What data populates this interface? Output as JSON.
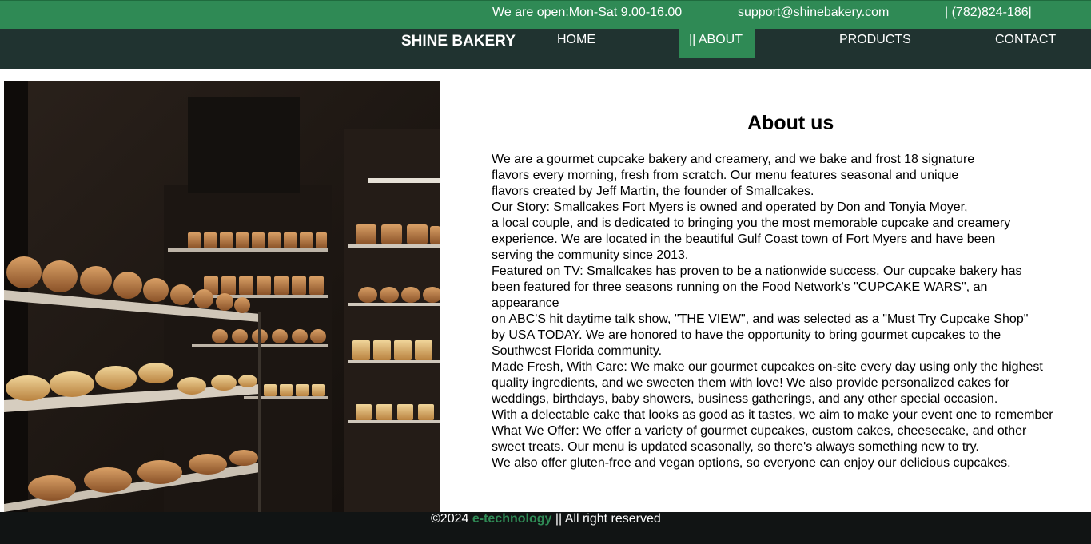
{
  "topbar": {
    "hours": "We are open:Mon-Sat 9.00-16.00",
    "email": "support@shinebakery.com",
    "phone": "| (782)824-186|"
  },
  "nav": {
    "brand": "SHINE BAKERY",
    "items": [
      {
        "label": "HOME"
      },
      {
        "label": "|| ABOUT"
      },
      {
        "label": "PRODUCTS"
      },
      {
        "label": "CONTACT"
      }
    ],
    "active_color": "#2f8a55"
  },
  "hero": {
    "image": "bakery-shelves-photo"
  },
  "about": {
    "title": "About us",
    "lines": [
      "We are a gourmet cupcake bakery and creamery, and we bake and frost 18 signature",
      "flavors every morning, fresh from scratch. Our menu features seasonal and unique",
      "flavors created by Jeff Martin, the founder of Smallcakes.",
      "Our Story: Smallcakes Fort Myers is owned and operated by Don and Tonyia Moyer,",
      "a local couple, and is dedicated to bringing you the most memorable cupcake and creamery",
      "experience. We are located in the beautiful Gulf Coast town of Fort Myers and have been",
      "serving the community since 2013.",
      "Featured on TV: Smallcakes has proven to be a nationwide success. Our cupcake bakery has",
      "been featured for three seasons running on the Food Network's \"CUPCAKE WARS\", an",
      "appearance",
      "on ABC'S hit daytime talk show, \"THE VIEW\", and was selected as a \"Must Try Cupcake Shop\"",
      "by USA TODAY. We are honored to have the opportunity to bring gourmet cupcakes to the",
      "Southwest Florida community.",
      "Made Fresh, With Care: We make our gourmet cupcakes on-site every day using only the highest",
      "quality ingredients, and we sweeten them with love! We also provide personalized cakes for",
      "weddings, birthdays, baby showers, business gatherings, and any other special occasion.",
      "With a delectable cake that looks as good as it tastes, we aim to make your event one to remember",
      "What We Offer: We offer a variety of gourmet cupcakes, custom cakes, cheesecake, and other",
      "sweet treats. Our menu is updated seasonally, so there's always something new to try.",
      "We also offer gluten-free and vegan options, so everyone can enjoy our delicious cupcakes."
    ]
  },
  "footer": {
    "prefix": "©2024",
    "brand": "e-technology",
    "suffix": "|| All right reserved"
  },
  "colors": {
    "topbar": "#2f8a55",
    "navbar": "#203330",
    "footer": "#111414"
  }
}
